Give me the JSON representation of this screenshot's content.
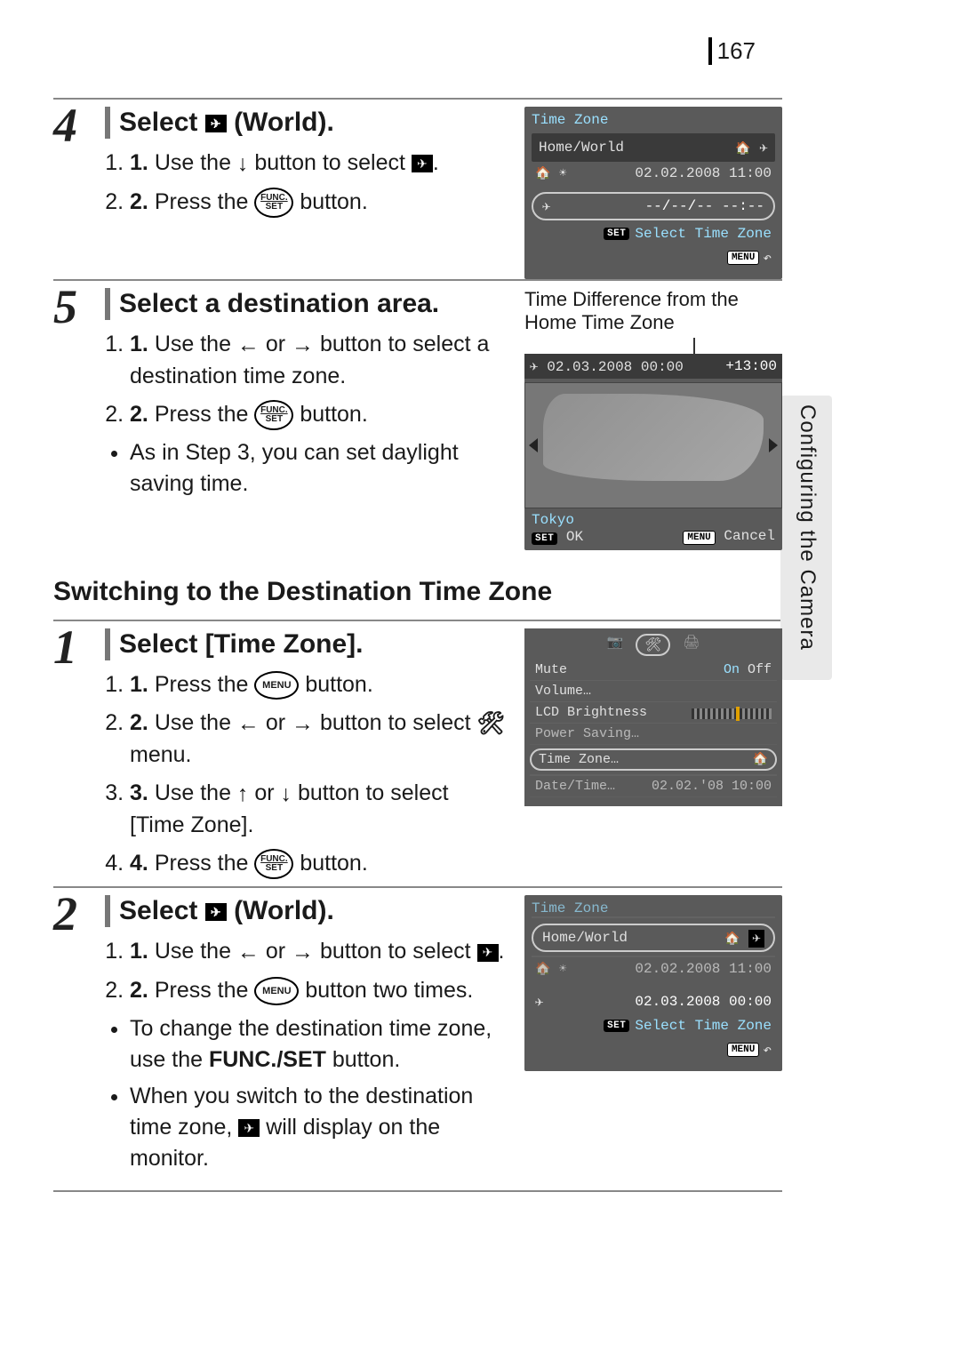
{
  "page_number": "167",
  "side_tab": "Configuring the Camera",
  "step4": {
    "num": "4",
    "title_pre": "Select ",
    "title_post": " (World).",
    "li1_a": "Use the ",
    "li1_b": " button to select ",
    "li1_c": ".",
    "li2_a": "Press the ",
    "li2_b": " button."
  },
  "lcd_tz": {
    "title": "Time Zone",
    "home_world": "Home/World",
    "home_date": "02.02.2008 11:00",
    "world_date": "--/--/-- --:--",
    "set_label": "SET",
    "select_tz": "Select Time Zone",
    "menu_label": "MENU"
  },
  "step5": {
    "num": "5",
    "title": "Select a destination area.",
    "li1_a": "Use the ",
    "li1_b": " or ",
    "li1_c": " button to select a destination time zone.",
    "li2_a": "Press the ",
    "li2_b": " button.",
    "bullet": "As in Step 3, you can set daylight saving time."
  },
  "annot": "Time Difference from the Home Time Zone",
  "lcd_map": {
    "header_date": "02.03.2008 00:00",
    "offset": "+13:00",
    "city": "Tokyo",
    "set_label": "SET",
    "ok": "OK",
    "menu_label": "MENU",
    "cancel": "Cancel"
  },
  "section": "Switching to the Destination Time Zone",
  "step1": {
    "num": "1",
    "title": "Select [Time Zone].",
    "li1_a": "Press the ",
    "li1_b": " button.",
    "li2_a": "Use the ",
    "li2_b": " or ",
    "li2_c": " button to select ",
    "li2_d": " menu.",
    "li3_a": "Use the ",
    "li3_b": " or ",
    "li3_c": " button to select [Time Zone].",
    "li4_a": "Press the ",
    "li4_b": " button."
  },
  "lcd_menu": {
    "mute": "Mute",
    "on": "On",
    "off": "Off",
    "volume": "Volume…",
    "lcd": "LCD Brightness",
    "power": "Power Saving…",
    "tz": "Time Zone…",
    "date": "Date/Time…",
    "date_val": "02.02.'08 10:00"
  },
  "step2": {
    "num": "2",
    "title_pre": "Select ",
    "title_post": " (World).",
    "li1_a": "Use the ",
    "li1_b": " or ",
    "li1_c": " button to select ",
    "li1_d": ".",
    "li2_a": "Press the ",
    "li2_b": " button two times.",
    "bullet1_a": "To change the destination time zone, use the ",
    "bullet1_b": "FUNC./SET",
    "bullet1_c": " button.",
    "bullet2_a": "When you switch to the destination time zone, ",
    "bullet2_b": " will display on the monitor."
  },
  "lcd_tz2": {
    "title": "Time Zone",
    "home_world": "Home/World",
    "home_date": "02.02.2008 11:00",
    "world_date": "02.03.2008 00:00",
    "set_label": "SET",
    "select_tz": "Select Time Zone",
    "menu_label": "MENU"
  },
  "icons": {
    "arrow_down": "↓",
    "arrow_up": "↑",
    "arrow_left": "←",
    "arrow_right": "→",
    "tools": "🛠",
    "undo": "↶"
  },
  "btn_func_top": "FUNC.",
  "btn_func_bot": "SET",
  "btn_menu": "MENU"
}
